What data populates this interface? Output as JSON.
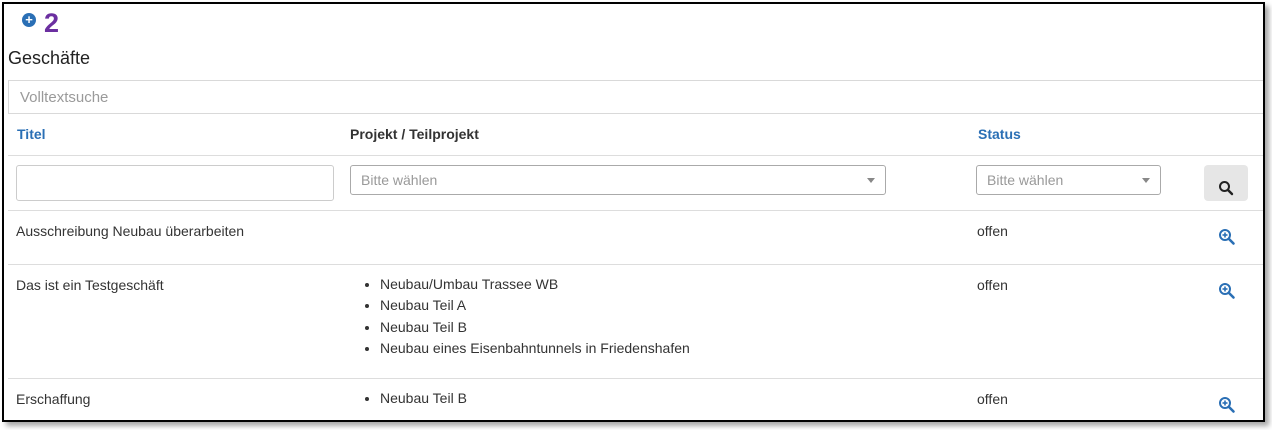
{
  "marker": {
    "number": "2"
  },
  "section": {
    "title": "Geschäfte"
  },
  "search": {
    "placeholder": "Volltextsuche"
  },
  "columns": {
    "titel": "Titel",
    "projekt": "Projekt / Teilprojekt",
    "status": "Status"
  },
  "filters": {
    "projekt_placeholder": "Bitte wählen",
    "status_placeholder": "Bitte wählen"
  },
  "rows": [
    {
      "titel": "Ausschreibung Neubau überarbeiten",
      "projekte": [],
      "status": "offen"
    },
    {
      "titel": "Das ist ein Testgeschäft",
      "projekte": [
        "Neubau/Umbau Trassee WB",
        "Neubau Teil A",
        "Neubau Teil B",
        "Neubau eines Eisenbahntunnels in Friedenshafen"
      ],
      "status": "offen"
    },
    {
      "titel": "Erschaffung",
      "projekte": [
        "Neubau Teil B"
      ],
      "status": "offen"
    }
  ],
  "colors": {
    "link": "#2a6fb5",
    "marker": "#6b2fa0"
  },
  "icons": {
    "marker": "plus-circle-icon",
    "search": "search-icon",
    "details": "zoom-in-icon"
  }
}
